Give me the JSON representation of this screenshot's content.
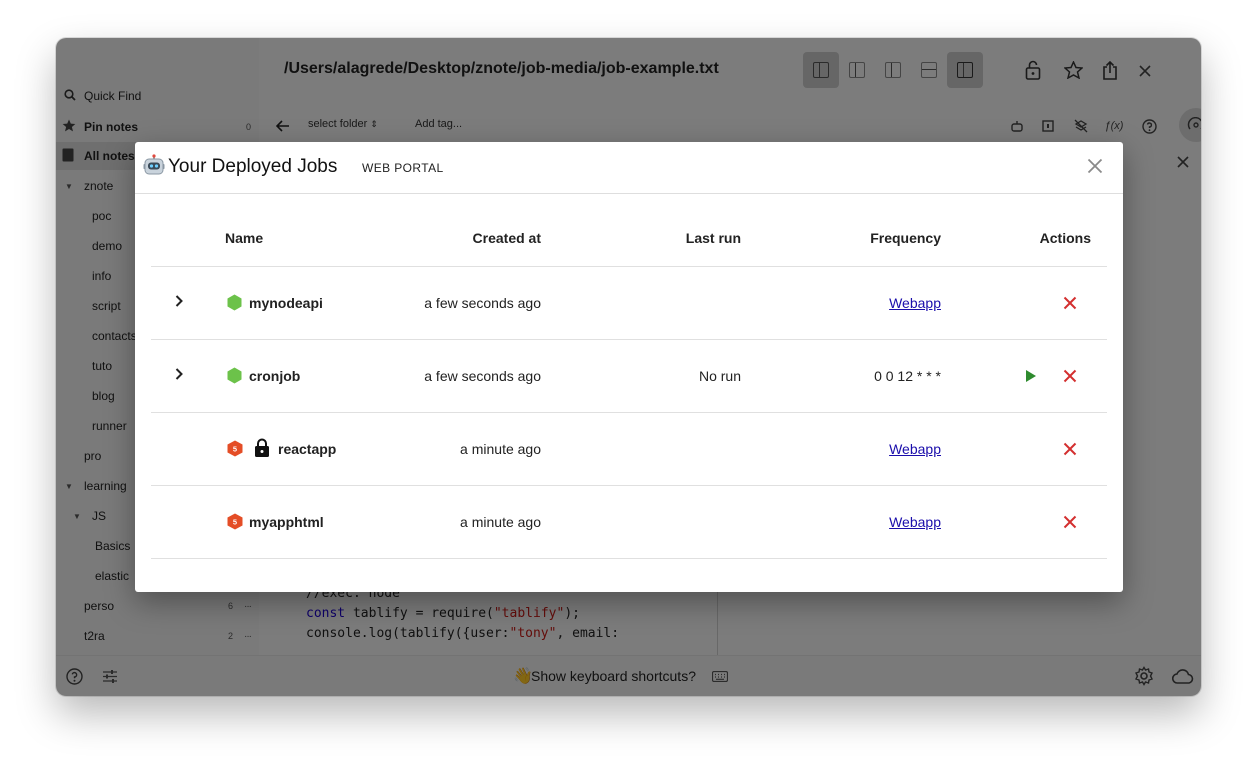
{
  "window": {
    "path": "/Users/alagrede/Desktop/znote/job-media/job-example.txt"
  },
  "sidebar": {
    "quick_find": "Quick Find",
    "pin_notes": "Pin notes",
    "pin_count": "0",
    "all_notes": "All notes",
    "items": [
      {
        "label": "znote",
        "indent": 1,
        "caret": true
      },
      {
        "label": "poc",
        "indent": 2
      },
      {
        "label": "demo",
        "indent": 2
      },
      {
        "label": "info",
        "indent": 2
      },
      {
        "label": "script",
        "indent": 2
      },
      {
        "label": "contacts",
        "indent": 2
      },
      {
        "label": "tuto",
        "indent": 2
      },
      {
        "label": "blog",
        "indent": 2
      },
      {
        "label": "runner",
        "indent": 2
      },
      {
        "label": "pro",
        "indent": 1
      },
      {
        "label": "learning",
        "indent": 1,
        "caret": true
      },
      {
        "label": "JS",
        "indent": 2,
        "caret": true
      },
      {
        "label": "Basics",
        "indent": 3
      },
      {
        "label": "elastic",
        "indent": 3
      },
      {
        "label": "perso",
        "indent": 1,
        "count": "6"
      },
      {
        "label": "t2ra",
        "indent": 1,
        "count": "2"
      }
    ]
  },
  "toolbar": {
    "select_folder": "select folder",
    "add_tag": "Add tag..."
  },
  "editor": {
    "line1": "//exec: node",
    "line2_kw": "const",
    "line2_rest": " tablify = require(",
    "line2_str": "\"tablify\"",
    "line2_end": ");",
    "line3_start": "console.log(tablify({user:",
    "line3_str": "\"tony\"",
    "line3_end": ", email:"
  },
  "statusbar": {
    "shortcuts": "Show keyboard shortcuts?"
  },
  "modal": {
    "title": "Your Deployed Jobs",
    "badge": "WEB PORTAL",
    "columns": {
      "name": "Name",
      "created": "Created at",
      "lastrun": "Last run",
      "frequency": "Frequency",
      "actions": "Actions"
    },
    "rows": [
      {
        "name": "mynodeapi",
        "icon": "nodejs-icon",
        "created": "a few seconds ago",
        "lastrun": "",
        "frequency": "Webapp",
        "freq_link": true,
        "expandable": true,
        "runnable": false,
        "locked": false
      },
      {
        "name": "cronjob",
        "icon": "nodejs-icon",
        "created": "a few seconds ago",
        "lastrun": "No run",
        "frequency": "0 0 12 * * *",
        "freq_link": false,
        "expandable": true,
        "runnable": true,
        "locked": false
      },
      {
        "name": "reactapp",
        "icon": "html5-icon",
        "created": "a minute ago",
        "lastrun": "",
        "frequency": "Webapp",
        "freq_link": true,
        "expandable": false,
        "runnable": false,
        "locked": true
      },
      {
        "name": "myapphtml",
        "icon": "html5-icon",
        "created": "a minute ago",
        "lastrun": "",
        "frequency": "Webapp",
        "freq_link": true,
        "expandable": false,
        "runnable": false,
        "locked": false
      }
    ]
  },
  "colors": {
    "node_green": "#6cc24a",
    "html5_orange": "#e44d26",
    "delete_red": "#d32f2f",
    "run_green": "#2e8b2e",
    "link_blue": "#1a0dab"
  }
}
